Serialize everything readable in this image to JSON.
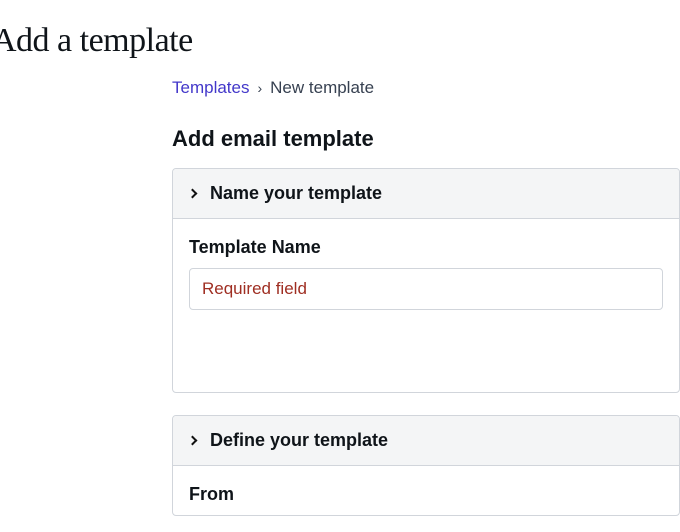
{
  "page_title": "Add a template",
  "breadcrumb": {
    "link_label": "Templates",
    "current": "New template"
  },
  "section_title": "Add email template",
  "card1": {
    "header": "Name your template",
    "field_label": "Template Name",
    "placeholder": "Required field",
    "value": ""
  },
  "card2": {
    "header": "Define your template",
    "field_label": "From"
  }
}
